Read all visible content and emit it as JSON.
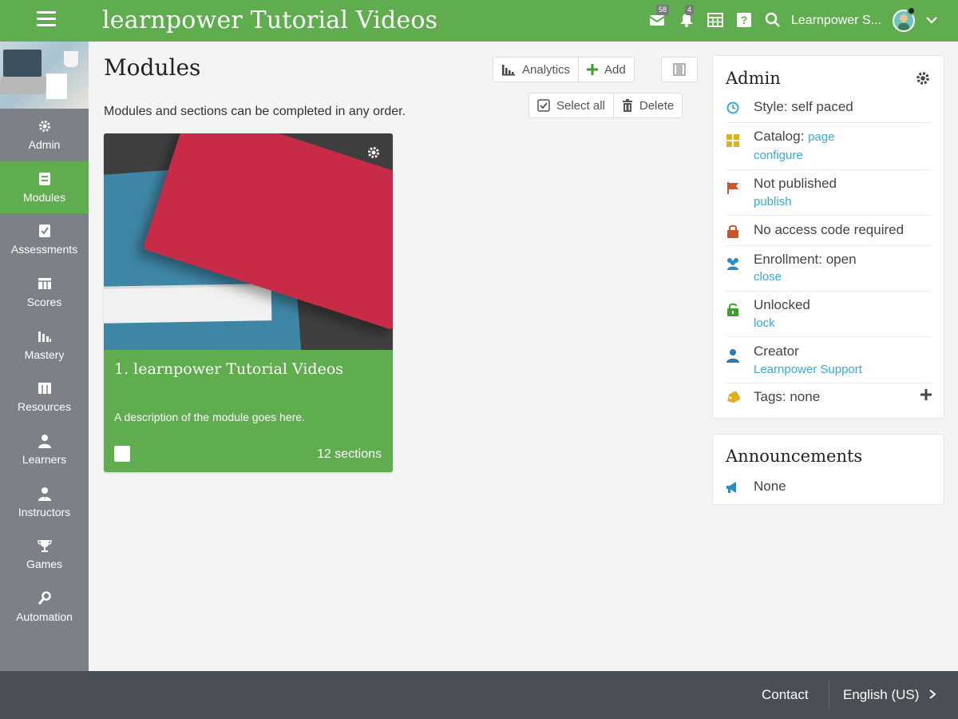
{
  "header": {
    "title": "learnpower Tutorial Videos",
    "messages_badge": "58",
    "notifications_badge": "4",
    "user_name": "Learnpower S..."
  },
  "sidebar": {
    "items": [
      {
        "label": "Admin",
        "icon": "gear-icon",
        "active": false
      },
      {
        "label": "Modules",
        "icon": "module-icon",
        "active": true
      },
      {
        "label": "Assessments",
        "icon": "checkbox-icon",
        "active": false
      },
      {
        "label": "Scores",
        "icon": "table-icon",
        "active": false
      },
      {
        "label": "Mastery",
        "icon": "bar-chart-icon",
        "active": false
      },
      {
        "label": "Resources",
        "icon": "resources-icon",
        "active": false
      },
      {
        "label": "Learners",
        "icon": "user-icon",
        "active": false
      },
      {
        "label": "Instructors",
        "icon": "instructor-icon",
        "active": false
      },
      {
        "label": "Games",
        "icon": "trophy-icon",
        "active": false
      },
      {
        "label": "Automation",
        "icon": "automation-icon",
        "active": false
      }
    ]
  },
  "main": {
    "title": "Modules",
    "subtitle": "Modules and sections can be completed in any order.",
    "toolbar": {
      "analytics_label": "Analytics",
      "add_label": "Add",
      "select_all_label": "Select all",
      "delete_label": "Delete"
    },
    "module": {
      "title": "1. learnpower Tutorial Videos",
      "description": "A description of the module goes here.",
      "sections": "12 sections"
    }
  },
  "admin": {
    "title": "Admin",
    "style": "Style: self paced",
    "catalog": "Catalog:",
    "catalog_link": "page",
    "catalog_configure": "configure",
    "published": "Not published",
    "publish_link": "publish",
    "access_code": "No access code required",
    "enrollment": "Enrollment: open",
    "enrollment_link": "close",
    "lock_status": "Unlocked",
    "lock_link": "lock",
    "creator_label": "Creator",
    "creator_name": "Learnpower Support",
    "tags": "Tags: none"
  },
  "announcements": {
    "title": "Announcements",
    "value": "None"
  },
  "footer": {
    "contact": "Contact",
    "language": "English (US)"
  },
  "colors": {
    "brand_green": "#5fad4f",
    "sidebar_gray": "#7d8187",
    "footer_dark": "#4a4f56",
    "link_blue": "#36a9e0"
  }
}
